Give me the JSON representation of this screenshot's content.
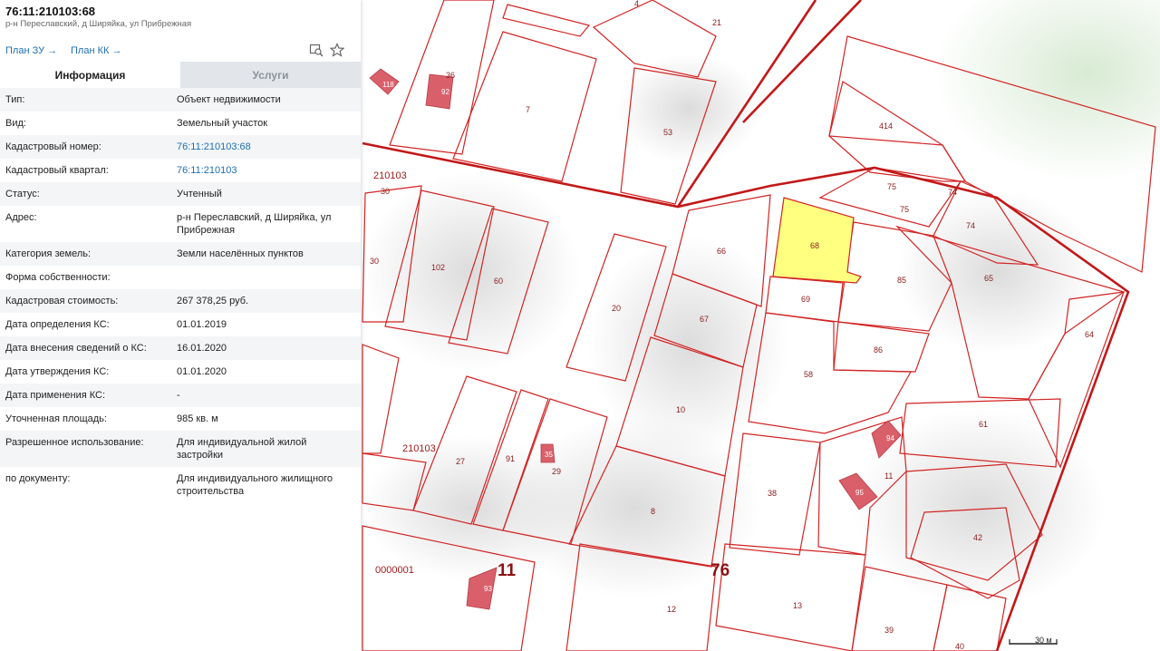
{
  "panel": {
    "title": "76:11:210103:68",
    "subtitle": "р-н Переславский, д Ширяйка, ул Прибрежная",
    "links": [
      "План ЗУ →",
      "План КК →"
    ],
    "tabs": [
      "Информация",
      "Услуги"
    ],
    "rows": [
      {
        "key": "Тип:",
        "value": "Объект недвижимости"
      },
      {
        "key": "Вид:",
        "value": "Земельный участок"
      },
      {
        "key": "Кадастровый номер:",
        "value": "76:11:210103:68"
      },
      {
        "key": "Кадастровый квартал:",
        "value": "76:11:210103"
      },
      {
        "key": "Статус:",
        "value": "Учтенный"
      },
      {
        "key": "Адрес:",
        "value": "р-н Переславский, д Ширяйка, ул Прибрежная"
      },
      {
        "key": "Категория земель:",
        "value": "Земли населённых пунктов"
      },
      {
        "key": "Форма собственности:",
        "value": ""
      },
      {
        "key": "Кадастровая стоимость:",
        "value": "267 378,25 руб."
      },
      {
        "key": "Дата определения КС:",
        "value": "01.01.2019"
      },
      {
        "key": "Дата внесения сведений о КС:",
        "value": "16.01.2020"
      },
      {
        "key": "Дата утверждения КС:",
        "value": "01.01.2020"
      },
      {
        "key": "Дата применения КС:",
        "value": "-"
      },
      {
        "key": "Уточненная площадь:",
        "value": "985 кв. м"
      },
      {
        "key": "Разрешенное использование:",
        "value": "Для индивидуальной жилой застройки"
      },
      {
        "key": "по документу:",
        "value": "Для индивидуального жилищного строительства"
      }
    ]
  },
  "map": {
    "parcel_labels": [
      "4",
      "21",
      "36",
      "7",
      "53",
      "414",
      "210103",
      "30",
      "75",
      "74",
      "75",
      "74",
      "66",
      "68",
      "85",
      "65",
      "102",
      "60",
      "20",
      "69",
      "67",
      "64",
      "86",
      "58",
      "10",
      "61",
      "210103",
      "27",
      "91",
      "29",
      "11",
      "38",
      "8",
      "42",
      "0000001",
      "11",
      "76",
      "12",
      "13",
      "39",
      "40",
      "30"
    ],
    "building_labels": [
      "118",
      "92",
      "35",
      "93",
      "94",
      "95"
    ],
    "scale_label": "30 м",
    "selected_color": "#ffff80",
    "boundary_color": "#d22424"
  }
}
